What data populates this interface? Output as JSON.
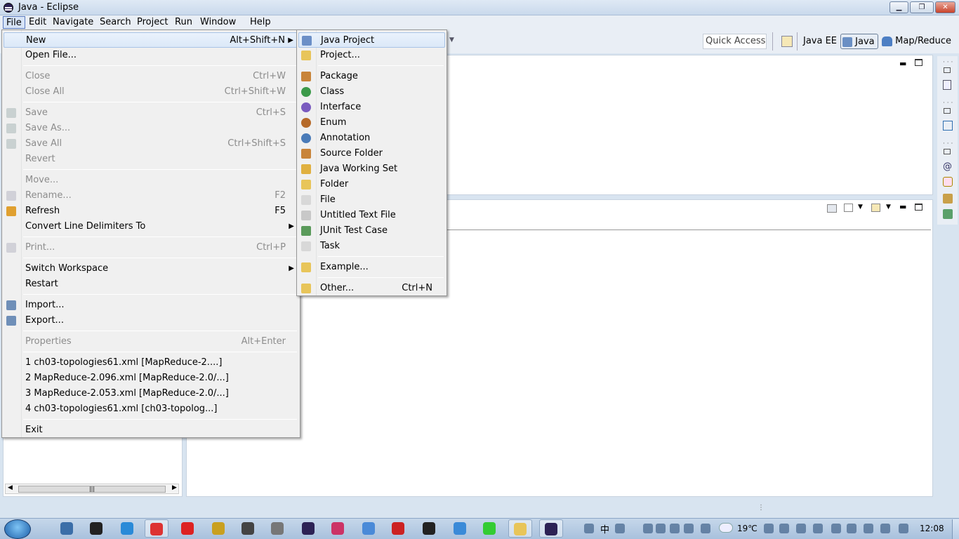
{
  "window": {
    "title": "Java - Eclipse"
  },
  "menubar": [
    "File",
    "Edit",
    "Navigate",
    "Search",
    "Project",
    "Run",
    "Window",
    "Help"
  ],
  "toolbar": {
    "quick_access": "Quick Access",
    "perspectives": [
      "Java EE",
      "Java",
      "Map/Reduce"
    ]
  },
  "file_menu": [
    {
      "label": "New",
      "accel": "Alt+Shift+N",
      "submenu": true,
      "hover": true
    },
    {
      "label": "Open File..."
    },
    {
      "sep": true
    },
    {
      "label": "Close",
      "accel": "Ctrl+W",
      "disabled": true
    },
    {
      "label": "Close All",
      "accel": "Ctrl+Shift+W",
      "disabled": true
    },
    {
      "sep": true
    },
    {
      "label": "Save",
      "accel": "Ctrl+S",
      "disabled": true,
      "icon": "save-icon"
    },
    {
      "label": "Save As...",
      "disabled": true,
      "icon": "save-as-icon"
    },
    {
      "label": "Save All",
      "accel": "Ctrl+Shift+S",
      "disabled": true,
      "icon": "save-all-icon"
    },
    {
      "label": "Revert",
      "disabled": true
    },
    {
      "sep": true
    },
    {
      "label": "Move...",
      "disabled": true
    },
    {
      "label": "Rename...",
      "accel": "F2",
      "disabled": true,
      "icon": "rename-icon"
    },
    {
      "label": "Refresh",
      "accel": "F5",
      "icon": "refresh-icon"
    },
    {
      "label": "Convert Line Delimiters To",
      "submenu": true
    },
    {
      "sep": true
    },
    {
      "label": "Print...",
      "accel": "Ctrl+P",
      "disabled": true,
      "icon": "print-icon"
    },
    {
      "sep": true
    },
    {
      "label": "Switch Workspace",
      "submenu": true
    },
    {
      "label": "Restart"
    },
    {
      "sep": true
    },
    {
      "label": "Import...",
      "icon": "import-icon"
    },
    {
      "label": "Export...",
      "icon": "export-icon"
    },
    {
      "sep": true
    },
    {
      "label": "Properties",
      "accel": "Alt+Enter",
      "disabled": true
    },
    {
      "sep": true
    },
    {
      "label": "1 ch03-topologies61.xml  [MapReduce-2....]"
    },
    {
      "label": "2 MapReduce-2.096.xml  [MapReduce-2.0/...]"
    },
    {
      "label": "3 MapReduce-2.053.xml  [MapReduce-2.0/...]"
    },
    {
      "label": "4 ch03-topologies61.xml  [ch03-topolog...]"
    },
    {
      "sep": true
    },
    {
      "label": "Exit"
    }
  ],
  "new_submenu": [
    {
      "label": "Java Project",
      "icon": "java-project-icon",
      "hover": true
    },
    {
      "label": "Project...",
      "icon": "project-icon"
    },
    {
      "sep": true
    },
    {
      "label": "Package",
      "icon": "package-icon"
    },
    {
      "label": "Class",
      "icon": "class-icon"
    },
    {
      "label": "Interface",
      "icon": "interface-icon"
    },
    {
      "label": "Enum",
      "icon": "enum-icon"
    },
    {
      "label": "Annotation",
      "icon": "annotation-icon"
    },
    {
      "label": "Source Folder",
      "icon": "source-folder-icon"
    },
    {
      "label": "Java Working Set",
      "icon": "working-set-icon"
    },
    {
      "label": "Folder",
      "icon": "folder-icon"
    },
    {
      "label": "File",
      "icon": "file-icon"
    },
    {
      "label": "Untitled Text File",
      "icon": "text-file-icon"
    },
    {
      "label": "JUnit Test Case",
      "icon": "junit-icon"
    },
    {
      "label": "Task",
      "icon": "task-icon"
    },
    {
      "sep": true
    },
    {
      "label": "Example...",
      "icon": "example-icon"
    },
    {
      "sep": true
    },
    {
      "label": "Other...",
      "accel": "Ctrl+N",
      "icon": "other-icon"
    }
  ],
  "taskbar": {
    "temperature": "19℃",
    "time": "12:08",
    "ime": "中"
  },
  "colors": {
    "menu_bg": "#f0f0f0",
    "hover": "#dbe8f8",
    "accent": "#5a7bbf"
  }
}
